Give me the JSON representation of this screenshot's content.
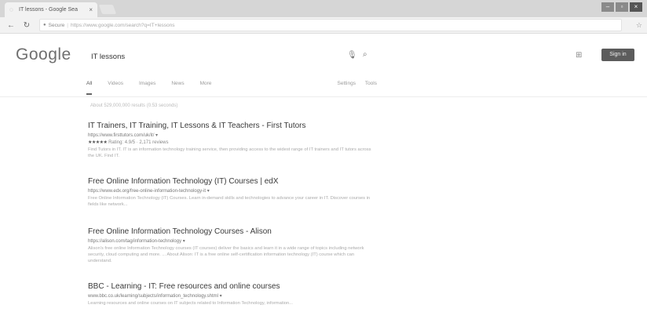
{
  "browser": {
    "tab_title": "IT lessons - Google Sea",
    "tab_close": "×",
    "url_prefix": "Secure",
    "url": "https://www.google.com/search?q=IT+lessons",
    "star": "☆",
    "win_min": "–",
    "win_max": "▫",
    "win_close": "×"
  },
  "google": {
    "logo": "Google",
    "query": "IT lessons",
    "signin": "Sign in"
  },
  "tabs": {
    "all": "All",
    "videos": "Videos",
    "images": "Images",
    "news": "News",
    "more": "More",
    "settings": "Settings",
    "tools": "Tools"
  },
  "stats": "About 529,000,000 results (0.53 seconds)",
  "results": [
    {
      "title": "IT Trainers, IT Training, IT Lessons & IT Teachers - First Tutors",
      "cite": "https://www.firsttutors.com/uk/it/ ▾",
      "stars": "★★★★★",
      "rating": "Rating: 4.9/5 · 2,171 reviews",
      "snippet": "Find Tutors in IT. IT is an information technology training service, then providing access to the widest range of IT trainers and IT tutors across the UK. Find IT."
    },
    {
      "title": "Free Online Information Technology (IT) Courses | edX",
      "cite": "https://www.edx.org/free-online-information-technology-it ▾",
      "snippet": "Free Online Information Technology (IT) Courses. Learn in-demand skills and technologies to advance your career in IT. Discover courses in fields like network..."
    },
    {
      "title": "Free Online Information Technology Courses - Alison",
      "cite": "https://alison.com/tag/information-technology ▾",
      "snippet": "Alison's free online Information Technology courses (IT courses) deliver the basics and learn it in a wide range of topics including network security, cloud computing and more. ... About Alison: IT is a free online self-certification information technology (IT) course which can understand."
    },
    {
      "title": "BBC - Learning - IT: Free resources and online courses",
      "cite": "www.bbc.co.uk/learning/subjects/information_technology.shtml ▾",
      "snippet": "Learning resources and online courses on IT subjects related to Information Technology, information..."
    }
  ]
}
